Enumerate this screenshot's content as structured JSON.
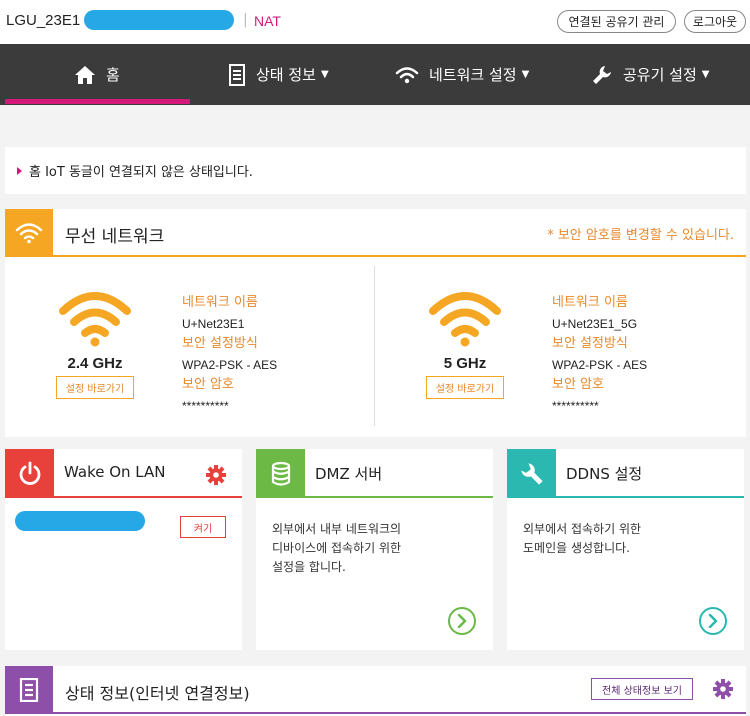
{
  "header": {
    "device_name": "LGU_23E1",
    "separator": "|",
    "mode": "NAT",
    "manage_button": "연결된 공유기 관리",
    "logout_button": "로그아웃"
  },
  "nav": {
    "home": "홈",
    "status": "상태 정보",
    "network": "네트워크 설정",
    "router": "공유기 설정",
    "caret": "▼"
  },
  "notice": "홈 IoT 동글이 연결되지 않은 상태입니다.",
  "wireless": {
    "title": "무선 네트워크",
    "note": "* 보안 암호를 변경할 수 있습니다.",
    "bands": [
      {
        "freq": "2.4 GHz",
        "goto": "설정 바로가기",
        "name_label": "네트워크 이름",
        "name": "U+Net23E1",
        "sec_label": "보안 설정방식",
        "sec": "WPA2-PSK - AES",
        "pw_label": "보안 암호",
        "pw": "**********"
      },
      {
        "freq": "5 GHz",
        "goto": "설정 바로가기",
        "name_label": "네트워크 이름",
        "name": "U+Net23E1_5G",
        "sec_label": "보안 설정방식",
        "sec": "WPA2-PSK - AES",
        "pw_label": "보안 암호",
        "pw": "**********"
      }
    ]
  },
  "cards": {
    "wol": {
      "title": "Wake On LAN",
      "button": "켜기"
    },
    "dmz": {
      "title": "DMZ 서버",
      "desc1": "외부에서 내부 네트워크의",
      "desc2": "디바이스에 접속하기 위한",
      "desc3": "설정을 합니다."
    },
    "ddns": {
      "title": "DDNS 설정",
      "desc1": "외부에서 접속하기 위한",
      "desc2": "도메인을 생성합니다."
    }
  },
  "status_panel": {
    "title": "상태 정보(인터넷 연결정보)",
    "button": "전체 상태정보 보기"
  },
  "colors": {
    "accent": "#d4187a",
    "wireless": "#f5a623",
    "wol": "#e8413c",
    "dmz": "#6cba45",
    "ddns": "#2bb8b0",
    "status": "#8e4fa8",
    "redaction": "#27a8e6"
  }
}
